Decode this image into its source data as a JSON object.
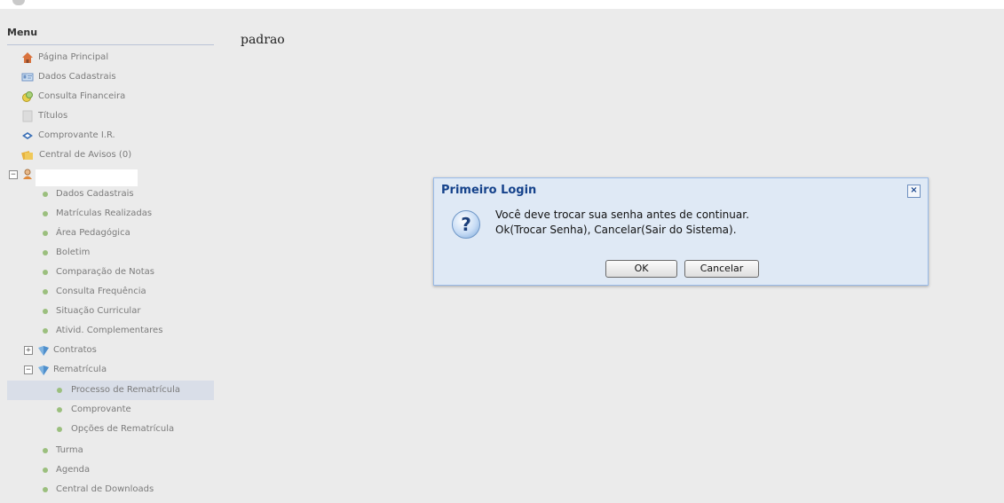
{
  "sidebar": {
    "title": "Menu",
    "top_items": [
      {
        "label": "Página Principal",
        "icon": "home-icon"
      },
      {
        "label": "Dados Cadastrais",
        "icon": "id-card-icon"
      },
      {
        "label": "Consulta Financeira",
        "icon": "money-icon"
      },
      {
        "label": "Títulos",
        "icon": "document-icon"
      },
      {
        "label": "Comprovante I.R.",
        "icon": "tax-receipt-icon"
      },
      {
        "label": "Central de Avisos (0)",
        "icon": "notice-icon"
      }
    ],
    "student_items": [
      "Dados Cadastrais",
      "Matrículas Realizadas",
      "Área Pedagógica",
      "Boletim",
      "Comparação de Notas",
      "Consulta Frequência",
      "Situação Curricular",
      "Ativid. Complementares"
    ],
    "contratos": {
      "label": "Contratos",
      "expander": "+"
    },
    "rematricula": {
      "label": "Rematrícula",
      "expander": "−",
      "children": [
        "Processo de Rematrícula",
        "Comprovante",
        "Opções de Rematrícula"
      ]
    },
    "bottom_items": [
      "Turma",
      "Agenda",
      "Central de Downloads"
    ],
    "user_expander": "−",
    "accent_bullet": "#9bbf7e"
  },
  "main": {
    "page_label": "padrao"
  },
  "dialog": {
    "title": "Primeiro Login",
    "close": "×",
    "icon": "question-icon",
    "line1": "Você deve trocar sua senha antes de continuar.",
    "line2": "Ok(Trocar Senha), Cancelar(Sair do Sistema).",
    "ok_label": "OK",
    "cancel_label": "Cancelar",
    "title_color": "#15428b"
  }
}
